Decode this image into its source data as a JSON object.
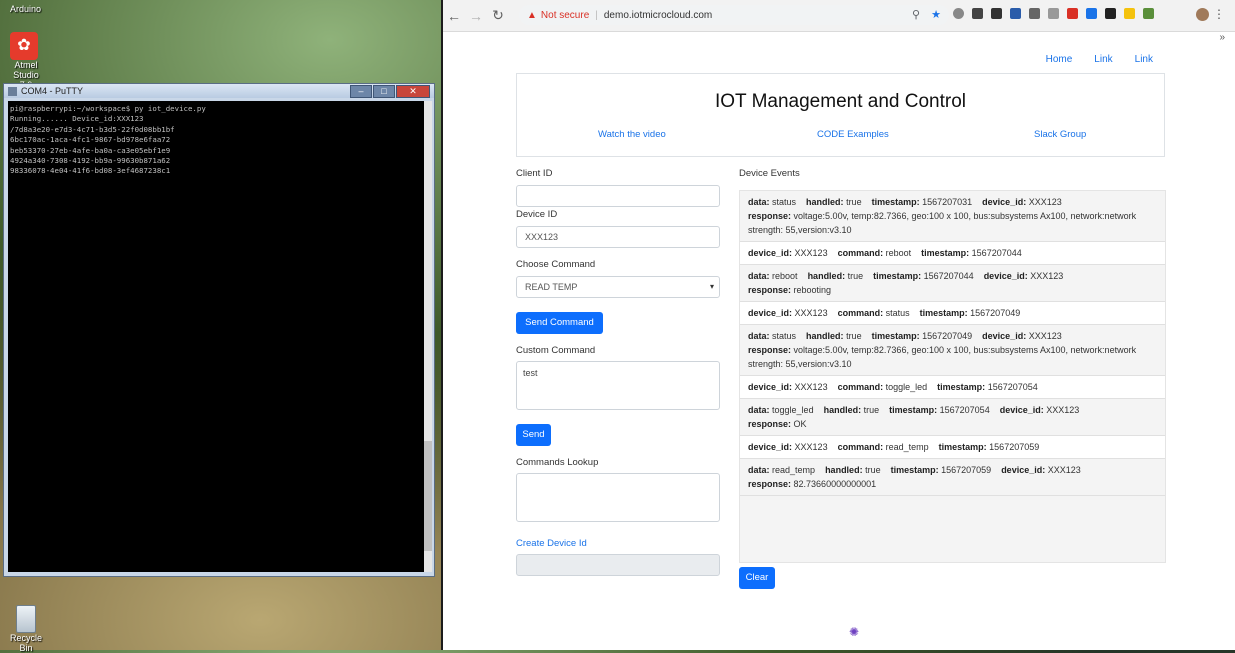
{
  "desktop": {
    "icons": [
      {
        "label": "Arduino"
      },
      {
        "label": "Atmel Studio 7.0"
      },
      {
        "label": "Recycle Bin"
      }
    ]
  },
  "putty": {
    "title": "COM4 - PuTTY",
    "lines": [
      "pi@raspberrypi:~/workspace$ py iot_device.py",
      "Running...... Device_id:XXX123",
      "/7d8a3e20-e7d3-4c71-b3d5-22f0d08bb1bf",
      "6bc170ac-1aca-4fc1-9867-bd978e6faa72",
      "beb53370-27eb-4afe-ba0a-ca3e05ebf1e9",
      "4924a340-7308-4192-bb9a-99630b871a62",
      "98336078-4e04-41f6-bd08-3ef4687238c1"
    ]
  },
  "browser": {
    "not_secure": "Not secure",
    "url": "demo.iotmicrocloud.com"
  },
  "nav": {
    "links": [
      "Home",
      "Link",
      "Link"
    ]
  },
  "header": {
    "title": "IOT Management and Control",
    "links": [
      "Watch the video",
      "CODE Examples",
      "Slack Group"
    ]
  },
  "form": {
    "client_id_label": "Client ID",
    "client_id_value": "",
    "device_id_label": "Device ID",
    "device_id_value": "XXX123",
    "choose_command_label": "Choose Command",
    "command_selected": "READ TEMP",
    "send_command_label": "Send Command",
    "custom_command_label": "Custom Command",
    "custom_command_value": "test",
    "send_label": "Send",
    "lookup_label": "Commands Lookup",
    "create_device_label": "Create Device Id"
  },
  "events": {
    "title": "Device Events",
    "clear_label": "Clear",
    "items": [
      {
        "lines": [
          [
            [
              "data:",
              "status"
            ],
            [
              "handled:",
              "true"
            ],
            [
              "timestamp:",
              "1567207031"
            ],
            [
              "device_id:",
              "XXX123"
            ]
          ],
          [
            [
              "response:",
              "voltage:5.00v, temp:82.7366, geo:100 x 100, bus:subsystems Ax100, network:network strength: 55,version:v3.10"
            ]
          ]
        ]
      },
      {
        "lines": [
          [
            [
              "device_id:",
              "XXX123"
            ],
            [
              "command:",
              "reboot"
            ],
            [
              "timestamp:",
              "1567207044"
            ]
          ]
        ]
      },
      {
        "lines": [
          [
            [
              "data:",
              "reboot"
            ],
            [
              "handled:",
              "true"
            ],
            [
              "timestamp:",
              "1567207044"
            ],
            [
              "device_id:",
              "XXX123"
            ]
          ],
          [
            [
              "response:",
              "rebooting"
            ]
          ]
        ]
      },
      {
        "lines": [
          [
            [
              "device_id:",
              "XXX123"
            ],
            [
              "command:",
              "status"
            ],
            [
              "timestamp:",
              "1567207049"
            ]
          ]
        ]
      },
      {
        "lines": [
          [
            [
              "data:",
              "status"
            ],
            [
              "handled:",
              "true"
            ],
            [
              "timestamp:",
              "1567207049"
            ],
            [
              "device_id:",
              "XXX123"
            ]
          ],
          [
            [
              "response:",
              "voltage:5.00v, temp:82.7366, geo:100 x 100, bus:subsystems Ax100, network:network strength: 55,version:v3.10"
            ]
          ]
        ]
      },
      {
        "lines": [
          [
            [
              "device_id:",
              "XXX123"
            ],
            [
              "command:",
              "toggle_led"
            ],
            [
              "timestamp:",
              "1567207054"
            ]
          ]
        ]
      },
      {
        "lines": [
          [
            [
              "data:",
              "toggle_led"
            ],
            [
              "handled:",
              "true"
            ],
            [
              "timestamp:",
              "1567207054"
            ],
            [
              "device_id:",
              "XXX123"
            ]
          ],
          [
            [
              "response:",
              "OK"
            ]
          ]
        ]
      },
      {
        "lines": [
          [
            [
              "device_id:",
              "XXX123"
            ],
            [
              "command:",
              "read_temp"
            ],
            [
              "timestamp:",
              "1567207059"
            ]
          ]
        ]
      },
      {
        "lines": [
          [
            [
              "data:",
              "read_temp"
            ],
            [
              "handled:",
              "true"
            ],
            [
              "timestamp:",
              "1567207059"
            ],
            [
              "device_id:",
              "XXX123"
            ]
          ],
          [
            [
              "response:",
              "82.73660000000001"
            ]
          ]
        ]
      }
    ]
  }
}
